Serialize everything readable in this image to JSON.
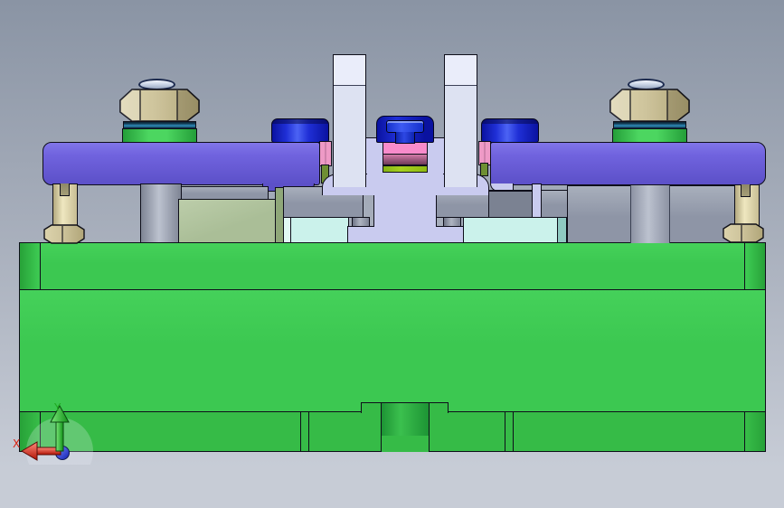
{
  "triad": {
    "x_label": "X",
    "y_label": "Y"
  },
  "colors": {
    "background_top": "#8a94a4",
    "background_mid": "#a9b0bd",
    "background_bottom": "#c7ccd6",
    "outline": "#0e0e1a",
    "base_green": "#3cc851",
    "base_green_row": "#36bb47",
    "base_green_dark": "#27a138",
    "recess_dark": "#1d9434",
    "recess_mid": "#3bc04e",
    "plate_purple": "#7063de",
    "plate_purple_hi": "#8175e8",
    "plate_purple_lo": "#5c50c8",
    "bracket_lavender": "#c9cbef",
    "prong_light": "#eaedfa",
    "prong_shade": "#dde2f2",
    "slab_gray": "#8e95a6",
    "slab_gray_hi": "#a8afbc",
    "block_gray_dark": "#7b8292",
    "stud_hi": "#bcc2cf",
    "stud_lo": "#7e8494",
    "sage": "#aabe97",
    "sage_hi": "#bccdaa",
    "sage_strip": "#8fa779",
    "cyan_pale": "#cbf2eb",
    "cyan_light": "#e2faf5",
    "cyan_dark": "#8fc9c1",
    "nut_tan": "#cec49c",
    "nut_tan_hi": "#dcd3ac",
    "nut_tan_lo": "#b0a578",
    "post_hi": "#efe7c0",
    "post_lo": "#b3a97f",
    "washer_dark": "#0d2b3f",
    "washer_light": "#2f8cba",
    "spacer_hi": "#4cd660",
    "spacer_lo": "#249e39",
    "blue_dark": "#0a12a0",
    "blue_mid": "#1f2fd6",
    "blue_light": "#4c63f4",
    "pink_bright": "#f88bcb",
    "pink_strip": "#ee9ac6",
    "mauve_hi": "#d37ba8",
    "mauve_lo": "#6e3a58",
    "chartreuse": "#a6d01f",
    "olive": "#6e8f33",
    "tip_dark": "#9aa7c0",
    "axis_x": "#d92211",
    "axis_y": "#1fa920",
    "axis_z": "#2437cc"
  }
}
